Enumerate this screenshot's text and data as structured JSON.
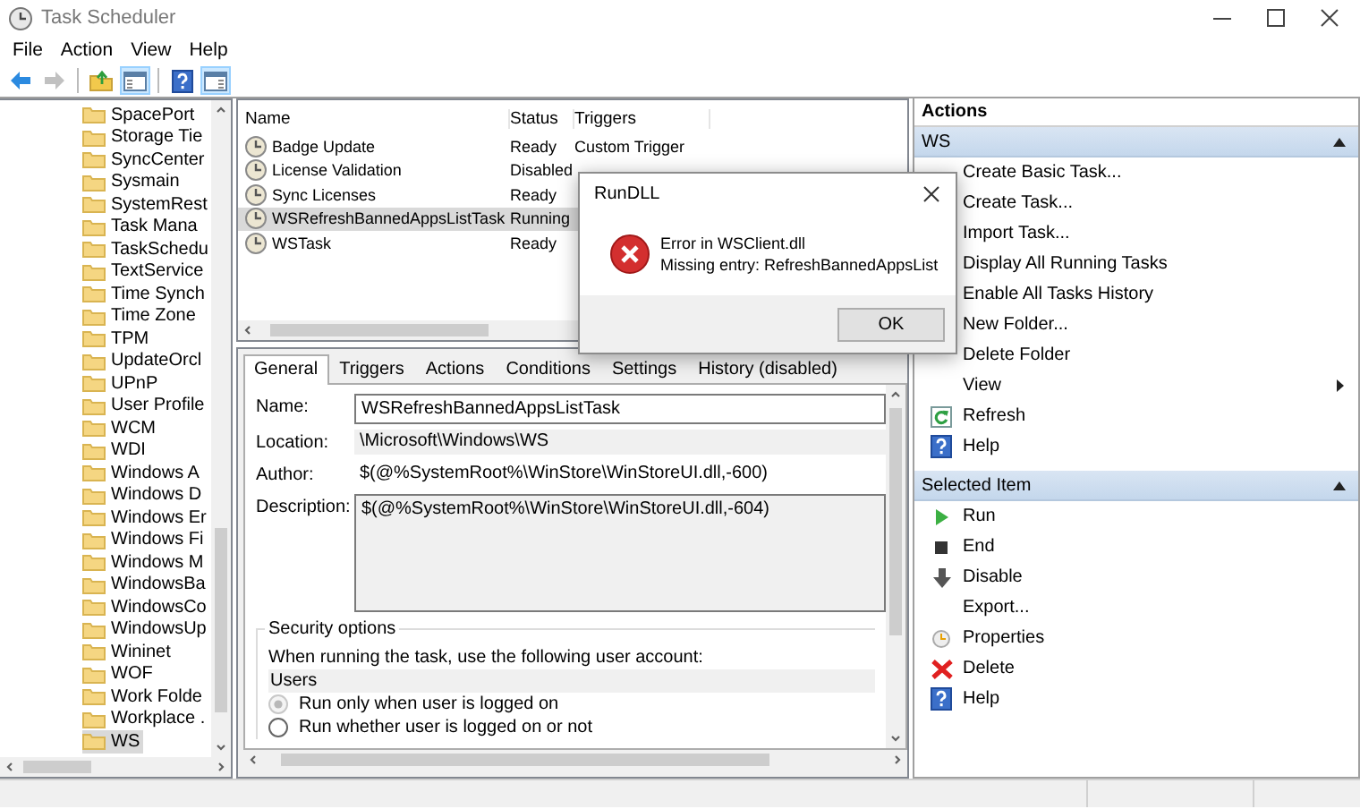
{
  "window": {
    "title": "Task Scheduler"
  },
  "menu": [
    "File",
    "Action",
    "View",
    "Help"
  ],
  "toolbar": [
    {
      "kind": "back",
      "disabled": false,
      "pressed": false
    },
    {
      "kind": "forward",
      "disabled": true,
      "pressed": false
    },
    {
      "kind": "separator"
    },
    {
      "kind": "up",
      "disabled": false,
      "pressed": false
    },
    {
      "kind": "tree-pane",
      "disabled": false,
      "pressed": true
    },
    {
      "kind": "separator"
    },
    {
      "kind": "help",
      "disabled": false,
      "pressed": false
    },
    {
      "kind": "action-pane",
      "disabled": false,
      "pressed": true
    }
  ],
  "tree": {
    "items": [
      {
        "label": "SpacePort",
        "selected": false
      },
      {
        "label": "Storage Tie",
        "selected": false
      },
      {
        "label": "SyncCenter",
        "selected": false
      },
      {
        "label": "Sysmain",
        "selected": false
      },
      {
        "label": "SystemRest",
        "selected": false
      },
      {
        "label": "Task Mana",
        "selected": false
      },
      {
        "label": "TaskSchedu",
        "selected": false
      },
      {
        "label": "TextService",
        "selected": false
      },
      {
        "label": "Time Synch",
        "selected": false
      },
      {
        "label": "Time Zone",
        "selected": false
      },
      {
        "label": "TPM",
        "selected": false
      },
      {
        "label": "UpdateOrcl",
        "selected": false
      },
      {
        "label": "UPnP",
        "selected": false
      },
      {
        "label": "User Profile",
        "selected": false
      },
      {
        "label": "WCM",
        "selected": false
      },
      {
        "label": "WDI",
        "selected": false
      },
      {
        "label": "Windows A",
        "selected": false
      },
      {
        "label": "Windows D",
        "selected": false
      },
      {
        "label": "Windows Er",
        "selected": false
      },
      {
        "label": "Windows Fi",
        "selected": false
      },
      {
        "label": "Windows M",
        "selected": false
      },
      {
        "label": "WindowsBa",
        "selected": false
      },
      {
        "label": "WindowsCo",
        "selected": false
      },
      {
        "label": "WindowsUp",
        "selected": false
      },
      {
        "label": "Wininet",
        "selected": false
      },
      {
        "label": "WOF",
        "selected": false
      },
      {
        "label": "Work Folde",
        "selected": false
      },
      {
        "label": "Workplace .",
        "selected": false
      },
      {
        "label": "WS",
        "selected": true
      }
    ]
  },
  "task_list": {
    "columns": [
      "Name",
      "Status",
      "Triggers"
    ],
    "rows": [
      {
        "name": "Badge Update",
        "status": "Ready",
        "triggers": "Custom Trigger",
        "selected": false
      },
      {
        "name": "License Validation",
        "status": "Disabled",
        "selected": false
      },
      {
        "name": "Sync Licenses",
        "status": "Ready",
        "selected": false
      },
      {
        "name": "WSRefreshBannedAppsListTask",
        "status": "Running",
        "selected": true
      },
      {
        "name": "WSTask",
        "status": "Ready",
        "selected": false
      }
    ]
  },
  "details": {
    "tabs": [
      {
        "label": "General",
        "selected": true
      },
      {
        "label": "Triggers",
        "selected": false
      },
      {
        "label": "Actions",
        "selected": false
      },
      {
        "label": "Conditions",
        "selected": false
      },
      {
        "label": "Settings",
        "selected": false
      },
      {
        "label": "History (disabled)",
        "selected": false
      }
    ],
    "fields": [
      {
        "kind": "input",
        "label": "Name:",
        "value": "WSRefreshBannedAppsListTask"
      },
      {
        "kind": "readonly",
        "label": "Location:",
        "value": "\\Microsoft\\Windows\\WS"
      },
      {
        "kind": "text",
        "label": "Author:",
        "value": "$(@%SystemRoot%\\WinStore\\WinStoreUI.dll,-600)"
      },
      {
        "kind": "textarea",
        "label": "Description:",
        "value": "$(@%SystemRoot%\\WinStore\\WinStoreUI.dll,-604)"
      }
    ],
    "security": {
      "title": "Security options",
      "prompt": "When running the task, use the following user account:",
      "account": "Users",
      "options": [
        {
          "label": "Run only when user is logged on",
          "selected": true
        },
        {
          "label": "Run whether user is logged on or not",
          "selected": false
        }
      ]
    }
  },
  "actions": {
    "title": "Actions",
    "sections": [
      {
        "title": "WS",
        "expanded": true,
        "items": [
          {
            "label": "Create Basic Task...",
            "submenu": false
          },
          {
            "label": "Create Task...",
            "submenu": false
          },
          {
            "label": "Import Task...",
            "submenu": false
          },
          {
            "label": "Display All Running Tasks",
            "submenu": false
          },
          {
            "label": "Enable All Tasks History",
            "submenu": false
          },
          {
            "label": "New Folder...",
            "submenu": false
          },
          {
            "label": "Delete Folder",
            "submenu": false
          },
          {
            "label": "View",
            "submenu": true
          },
          {
            "label": "Refresh",
            "kind": "refresh",
            "submenu": false
          },
          {
            "label": "Help",
            "kind": "help",
            "submenu": false
          }
        ]
      },
      {
        "title": "Selected Item",
        "expanded": true,
        "items": [
          {
            "label": "Run",
            "kind": "run",
            "submenu": false
          },
          {
            "label": "End",
            "kind": "end",
            "submenu": false
          },
          {
            "label": "Disable",
            "kind": "disable",
            "submenu": false
          },
          {
            "label": "Export...",
            "submenu": false
          },
          {
            "label": "Properties",
            "kind": "properties",
            "submenu": false
          },
          {
            "label": "Delete",
            "kind": "delete",
            "submenu": false
          },
          {
            "label": "Help",
            "kind": "help",
            "submenu": false
          }
        ]
      }
    ]
  },
  "dialog": {
    "title": "RunDLL",
    "kind": "error",
    "lines": [
      "Error in WSClient.dll",
      "Missing entry: RefreshBannedAppsList"
    ],
    "button": "OK"
  }
}
